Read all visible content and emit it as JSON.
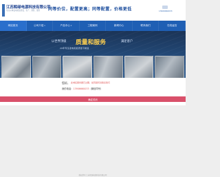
{
  "header": {
    "company_name": "江苏辉绿电源科技有限公司",
    "company_sub": "专业从事发电机组研发、生产、销售、服务",
    "slogan": "同等价位，配置更高；同等配置，价格更低",
    "hotline": "13906660033"
  },
  "nav": {
    "items": [
      {
        "label": "网站首页",
        "active": true
      },
      {
        "label": "公司介绍",
        "caret": true
      },
      {
        "label": "产品中心",
        "caret": true
      },
      {
        "label": "工程案例"
      },
      {
        "label": "新闻中心"
      },
      {
        "label": "联系我们"
      },
      {
        "label": "在线留言"
      }
    ]
  },
  "banner": {
    "line1_left": "以世界顶级",
    "line1_highlight": "质量和服务",
    "line1_right": "满足客户",
    "subtitle": "20年专注发电机组研发与制造"
  },
  "modal": {
    "greeting": "您好，",
    "notice": "此域名服务器已过期，如有疑问请联系我们",
    "contact_label": "我的电话：",
    "contact_number": "13906660033",
    "contact_suffix": "（微信同号）",
    "confirm_label": "确定关闭"
  },
  "footer": {
    "text": "版权所有 江苏辉绿电源科技有限公司"
  }
}
